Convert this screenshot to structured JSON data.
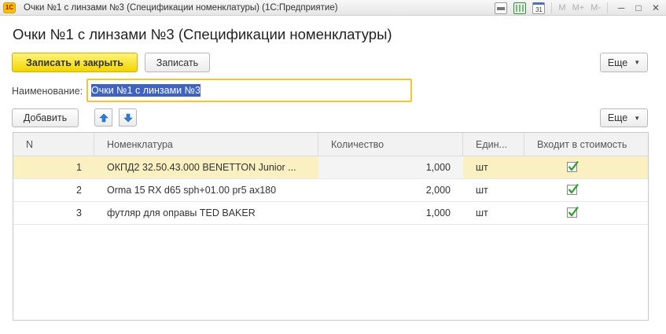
{
  "window": {
    "title": "Очки №1 с линзами №3 (Спецификации номенклатуры)  (1С:Предприятие)",
    "logo": "1С",
    "tools": {
      "m_label": "M",
      "m_plus_label": "M+",
      "m_minus_label": "M-",
      "calendar_day": "31",
      "minimize": "─",
      "restore": "□",
      "close": "✕"
    }
  },
  "form": {
    "title": "Очки №1 с линзами №3 (Спецификации номенклатуры)",
    "buttons": {
      "save_close": "Записать и закрыть",
      "save": "Записать",
      "more": "Еще",
      "more_table": "Еще",
      "add": "Добавить"
    },
    "name_label": "Наименование:",
    "name_value": "Очки №1 с линзами №3"
  },
  "table": {
    "columns": [
      "N",
      "Номенклатура",
      "Количество",
      "Един...",
      "Входит в стоимость"
    ],
    "rows": [
      {
        "n": "1",
        "item": "ОКПД2 32.50.43.000 BENETTON Junior ...",
        "qty": "1,000",
        "unit": "шт",
        "included": true
      },
      {
        "n": "2",
        "item": "Orma 15 RX d65 sph+01.00 pr5 ax180",
        "qty": "2,000",
        "unit": "шт",
        "included": true
      },
      {
        "n": "3",
        "item": "футляр для оправы TED BAKER",
        "qty": "1,000",
        "unit": "шт",
        "included": true
      }
    ]
  },
  "colors": {
    "accent_yellow": "#f3d400",
    "focus_border": "#f2c633",
    "selection_blue": "#3e63c4",
    "selected_row": "#fbf0c1",
    "check_green": "#2aa02a"
  }
}
